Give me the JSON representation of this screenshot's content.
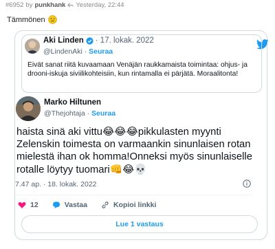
{
  "post": {
    "id": "#6952",
    "by": "by",
    "author": "punkhank",
    "time": "Yesterday, 22:44",
    "text": "Tämmönen"
  },
  "quoted_tweet": {
    "name": "Aki Linden",
    "date": "· 17. lokak. 2022",
    "handle": "@LindenAki",
    "follow": "Seuraa",
    "body": "Eivät sanat riitä kuvaamaan Venäjän raukkamaista toimintaa: ohjus- ja drooni-iskuja siviilikohteisiin, kun rintamalla ei pärjätä. Moraalitonta!"
  },
  "tweet": {
    "name": "Marko Hiltunen",
    "handle": "@Thejohtaja",
    "follow": "Seuraa",
    "body": "haista sinä aki vittu😂😂😂pikkulasten myynti Zelenskin toimesta on varmaankin sinunlaisen rotan mielestä ihan ok homma!Onneksi myös sinunlaiselle rotalle löytyy tuomari👊😂💀",
    "date": "7.47 ap. · 18. lokak. 2022",
    "likes": "12",
    "reply_label": "Vastaa",
    "copy_label": "Kopioi linkki",
    "replies_button": "Lue 1 vastaus"
  },
  "colors": {
    "accent": "#1d9bf0",
    "like": "#f91880",
    "border": "#cfd9de",
    "muted": "#536471"
  },
  "icons": [
    "reply-icon-small",
    "confused-face-emoji",
    "twitter-bird-icon",
    "verified-badge-icon",
    "info-icon",
    "heart-icon",
    "speech-bubble-icon",
    "link-icon"
  ]
}
